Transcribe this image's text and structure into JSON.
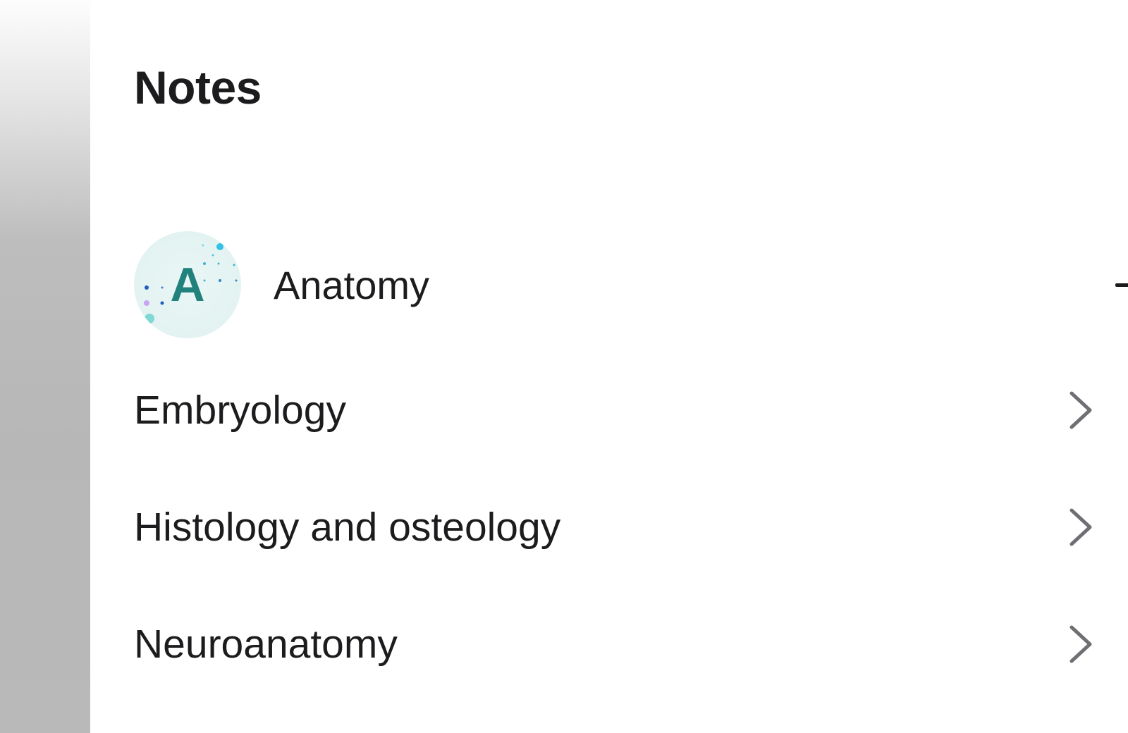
{
  "page": {
    "title": "Notes"
  },
  "section": {
    "avatar_letter": "A",
    "label": "Anatomy",
    "icon": "minus-icon",
    "expanded": true
  },
  "items": [
    {
      "label": "Embryology",
      "icon": "chevron-right-icon"
    },
    {
      "label": "Histology and osteology",
      "icon": "chevron-right-icon"
    },
    {
      "label": "Neuroanatomy",
      "icon": "chevron-right-icon"
    }
  ],
  "colors": {
    "accent_teal": "#21817c",
    "avatar_bg": "#e3f3f2",
    "text": "#1c1c1e",
    "chevron": "#6e6e73"
  }
}
